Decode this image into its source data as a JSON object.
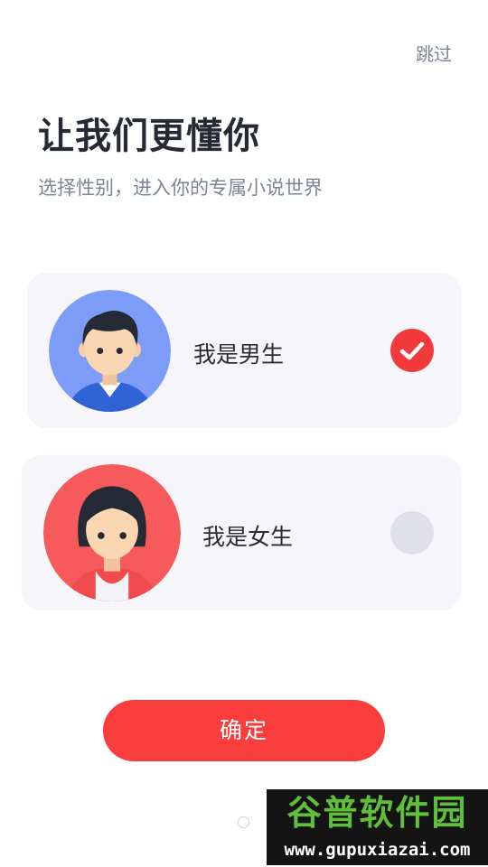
{
  "header": {
    "skip_label": "跳过",
    "title": "让我们更懂你",
    "subtitle": "选择性别，进入你的专属小说世界"
  },
  "options": [
    {
      "label": "我是男生",
      "selected": true,
      "avatar_icon": "male-avatar-icon",
      "avatar_bg": "#7c9cf7"
    },
    {
      "label": "我是女生",
      "selected": false,
      "avatar_icon": "female-avatar-icon",
      "avatar_bg": "#f75a5a"
    }
  ],
  "confirm_label": "确定",
  "watermark": {
    "top": "谷普软件园",
    "bottom": "www.gupuxiazai.com"
  },
  "colors": {
    "accent": "#f93d3c",
    "card_bg": "#f5f5fa",
    "unchecked": "#e0e0ec"
  }
}
